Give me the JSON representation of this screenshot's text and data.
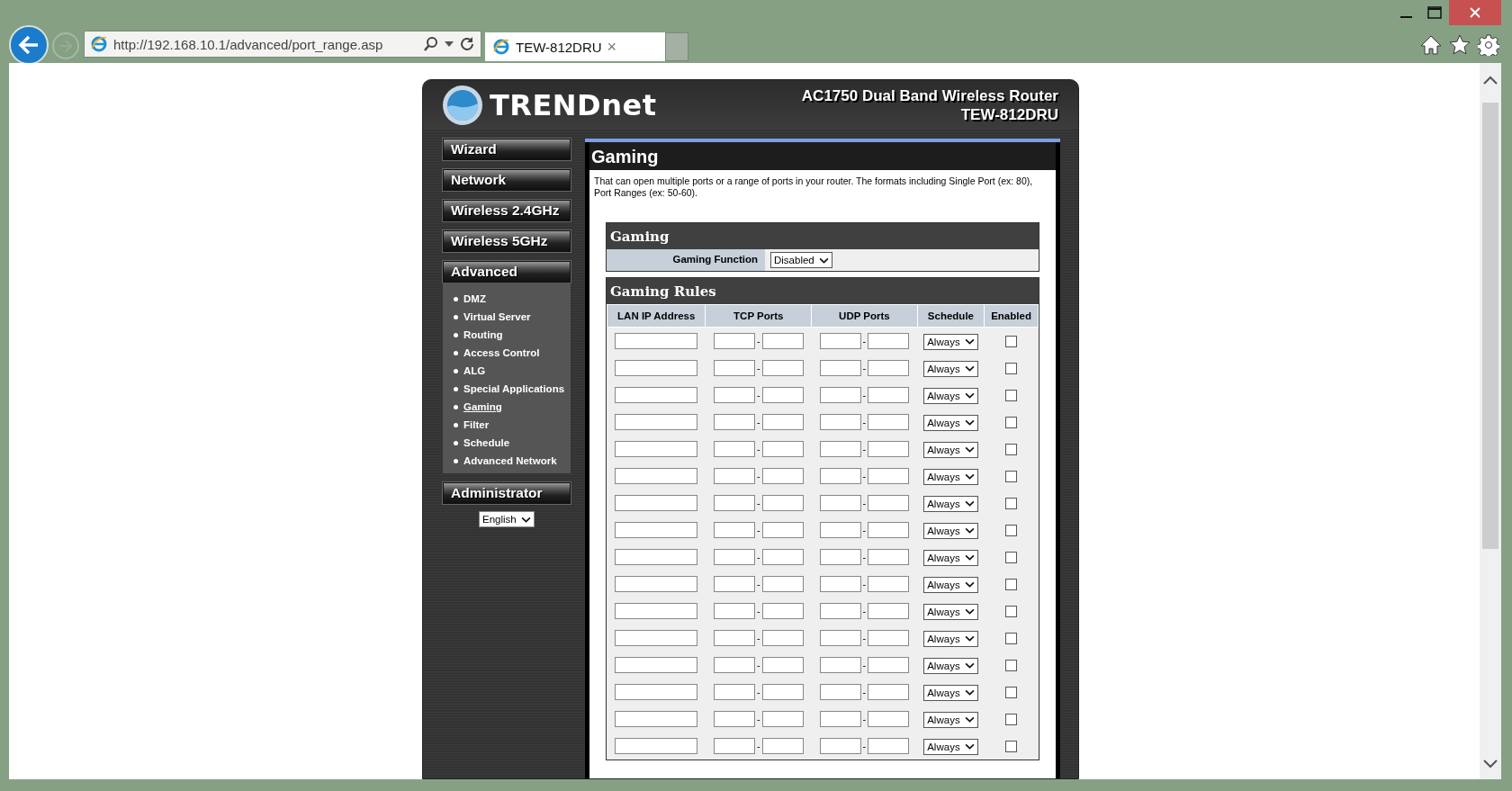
{
  "browser": {
    "url": "http://192.168.10.1/advanced/port_range.asp",
    "tab_title": "TEW-812DRU",
    "tab_close": "×"
  },
  "header": {
    "logo": "TRENDnet",
    "product": "AC1750 Dual Band Wireless Router",
    "model": "TEW-812DRU"
  },
  "sidebar": {
    "menus": [
      {
        "label": "Wizard"
      },
      {
        "label": "Network"
      },
      {
        "label": "Wireless 2.4GHz"
      },
      {
        "label": "Wireless 5GHz"
      },
      {
        "label": "Advanced",
        "children": [
          {
            "label": "DMZ",
            "selected": false
          },
          {
            "label": "Virtual Server",
            "selected": false
          },
          {
            "label": "Routing",
            "selected": false
          },
          {
            "label": "Access Control",
            "selected": false
          },
          {
            "label": "ALG",
            "selected": false
          },
          {
            "label": "Special Applications",
            "selected": false
          },
          {
            "label": "Gaming",
            "selected": true
          },
          {
            "label": "Filter",
            "selected": false
          },
          {
            "label": "Schedule",
            "selected": false
          },
          {
            "label": "Advanced Network",
            "selected": false
          }
        ]
      },
      {
        "label": "Administrator"
      }
    ],
    "language": "English"
  },
  "content": {
    "title": "Gaming",
    "description": "That can open multiple ports or a range of ports in your router. The formats including Single Port (ex: 80), Port Ranges (ex: 50-60).",
    "gaming": {
      "title": "Gaming",
      "field_label": "Gaming Function",
      "value": "Disabled"
    },
    "rules": {
      "title": "Gaming Rules",
      "columns": [
        "LAN IP Address",
        "TCP Ports",
        "UDP Ports",
        "Schedule",
        "Enabled"
      ],
      "rows": [
        {
          "tcp_separator": "-",
          "udp_separator": "-",
          "schedule": "Always",
          "enabled": false
        },
        {
          "tcp_separator": "-",
          "udp_separator": "-",
          "schedule": "Always",
          "enabled": false
        },
        {
          "tcp_separator": "-",
          "udp_separator": "-",
          "schedule": "Always",
          "enabled": false
        },
        {
          "tcp_separator": "-",
          "udp_separator": "-",
          "schedule": "Always",
          "enabled": false
        },
        {
          "tcp_separator": "-",
          "udp_separator": "-",
          "schedule": "Always",
          "enabled": false
        },
        {
          "tcp_separator": "-",
          "udp_separator": "-",
          "schedule": "Always",
          "enabled": false
        },
        {
          "tcp_separator": "-",
          "udp_separator": "-",
          "schedule": "Always",
          "enabled": false
        },
        {
          "tcp_separator": "-",
          "udp_separator": "-",
          "schedule": "Always",
          "enabled": false
        },
        {
          "tcp_separator": "-",
          "udp_separator": "-",
          "schedule": "Always",
          "enabled": false
        },
        {
          "tcp_separator": "-",
          "udp_separator": "-",
          "schedule": "Always",
          "enabled": false
        },
        {
          "tcp_separator": "-",
          "udp_separator": "-",
          "schedule": "Always",
          "enabled": false
        },
        {
          "tcp_separator": "-",
          "udp_separator": "-",
          "schedule": "Always",
          "enabled": false
        },
        {
          "tcp_separator": "-",
          "udp_separator": "-",
          "schedule": "Always",
          "enabled": false
        },
        {
          "tcp_separator": "-",
          "udp_separator": "-",
          "schedule": "Always",
          "enabled": false
        },
        {
          "tcp_separator": "-",
          "udp_separator": "-",
          "schedule": "Always",
          "enabled": false
        },
        {
          "tcp_separator": "-",
          "udp_separator": "-",
          "schedule": "Always",
          "enabled": false
        }
      ]
    }
  }
}
